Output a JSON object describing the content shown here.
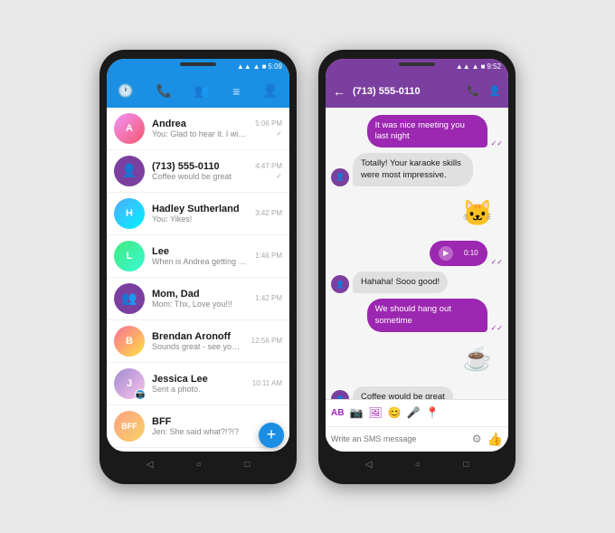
{
  "phone1": {
    "statusBar": {
      "time": "5:09",
      "icons": "▲▲▲■"
    },
    "header": {
      "icons": [
        "🕐",
        "📞",
        "👥",
        "≡",
        "👤"
      ]
    },
    "conversations": [
      {
        "name": "Andrea",
        "preview": "You: Glad to hear it. I will let him know...",
        "time": "5:06 PM",
        "avatarType": "photo",
        "avatarClass": "av-andrea",
        "initials": "A"
      },
      {
        "name": "(713) 555-0110",
        "preview": "Coffee would be great",
        "time": "4:47 PM",
        "avatarType": "icon",
        "avatarClass": "purple-bg",
        "initials": "👤"
      },
      {
        "name": "Hadley Sutherland",
        "preview": "You: Yikes!",
        "time": "3:42 PM",
        "avatarType": "photo",
        "avatarClass": "av-hadley",
        "initials": "H"
      },
      {
        "name": "Lee",
        "preview": "When is Andrea getting in?",
        "time": "1:46 PM",
        "avatarType": "photo",
        "avatarClass": "av-lee",
        "initials": "L"
      },
      {
        "name": "Mom, Dad",
        "preview": "Mom: Thx, Love you!!!",
        "time": "1:42 PM",
        "avatarType": "icon",
        "avatarClass": "purple-bg",
        "initials": "👥"
      },
      {
        "name": "Brendan Aronoff",
        "preview": "Sounds great - see you then!",
        "time": "12:56 PM",
        "avatarType": "photo",
        "avatarClass": "av-brendan",
        "initials": "B"
      },
      {
        "name": "Jessica Lee",
        "preview": "Sent a photo.",
        "time": "10:11 AM",
        "avatarType": "photo",
        "avatarClass": "av-jessica",
        "initials": "J"
      },
      {
        "name": "BFF",
        "preview": "Jen: She said what?!?!?",
        "time": "",
        "avatarType": "photo",
        "avatarClass": "av-bff",
        "initials": "B"
      }
    ],
    "fab": "+"
  },
  "phone2": {
    "statusBar": {
      "time": "9:52",
      "icons": "▲▲▲■"
    },
    "header": {
      "title": "(713) 555-0110",
      "backArrow": "←",
      "phoneIcon": "📞",
      "addIcon": "👤+"
    },
    "messages": [
      {
        "type": "sent",
        "text": "It was nice meeting you last night",
        "checked": true
      },
      {
        "type": "received",
        "text": "Totally! Your karaoke skills were most impressive.",
        "hasAvatar": true
      },
      {
        "type": "sticker",
        "emoji": "🐱",
        "align": "right"
      },
      {
        "type": "audio",
        "duration": "0:10",
        "align": "right"
      },
      {
        "type": "received",
        "text": "Hahaha! Sooo good!",
        "hasAvatar": true
      },
      {
        "type": "sent",
        "text": "We should hang out sometime",
        "checked": true
      },
      {
        "type": "sticker",
        "emoji": "☕",
        "align": "right",
        "isCoffee": true
      },
      {
        "type": "received",
        "text": "Coffee would be great",
        "hasAvatar": true
      }
    ],
    "toolbar": {
      "icons": [
        "AB",
        "📷",
        "🖼",
        "😊",
        "🎤",
        "📍"
      ],
      "inputPlaceholder": "Write an SMS message",
      "thumbUp": "👍"
    },
    "navButtons": [
      "◁",
      "○",
      "□"
    ]
  }
}
